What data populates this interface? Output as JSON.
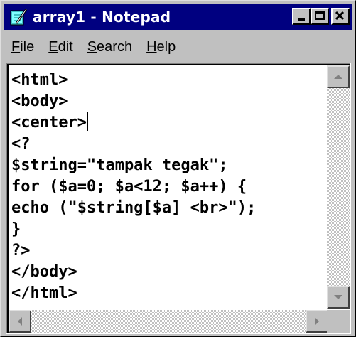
{
  "window": {
    "title": "array1 - Notepad",
    "title_bar_color": "#000080",
    "icon": "notepad-icon",
    "controls": [
      "minimize-icon",
      "maximize-icon",
      "close-icon"
    ]
  },
  "menu": {
    "items": [
      {
        "label": "File",
        "mnemonic": "F"
      },
      {
        "label": "Edit",
        "mnemonic": "E"
      },
      {
        "label": "Search",
        "mnemonic": "S"
      },
      {
        "label": "Help",
        "mnemonic": "H"
      }
    ]
  },
  "editor": {
    "lines": [
      "<html>",
      "<body>",
      "<center>",
      "<?",
      "$string=\"tampak tegak\";",
      "for ($a=0; $a<12; $a++) {",
      "echo (\"$string[$a] <br>\");",
      "}",
      "?>",
      "</body>",
      "</html>"
    ],
    "caret_line": 3
  }
}
